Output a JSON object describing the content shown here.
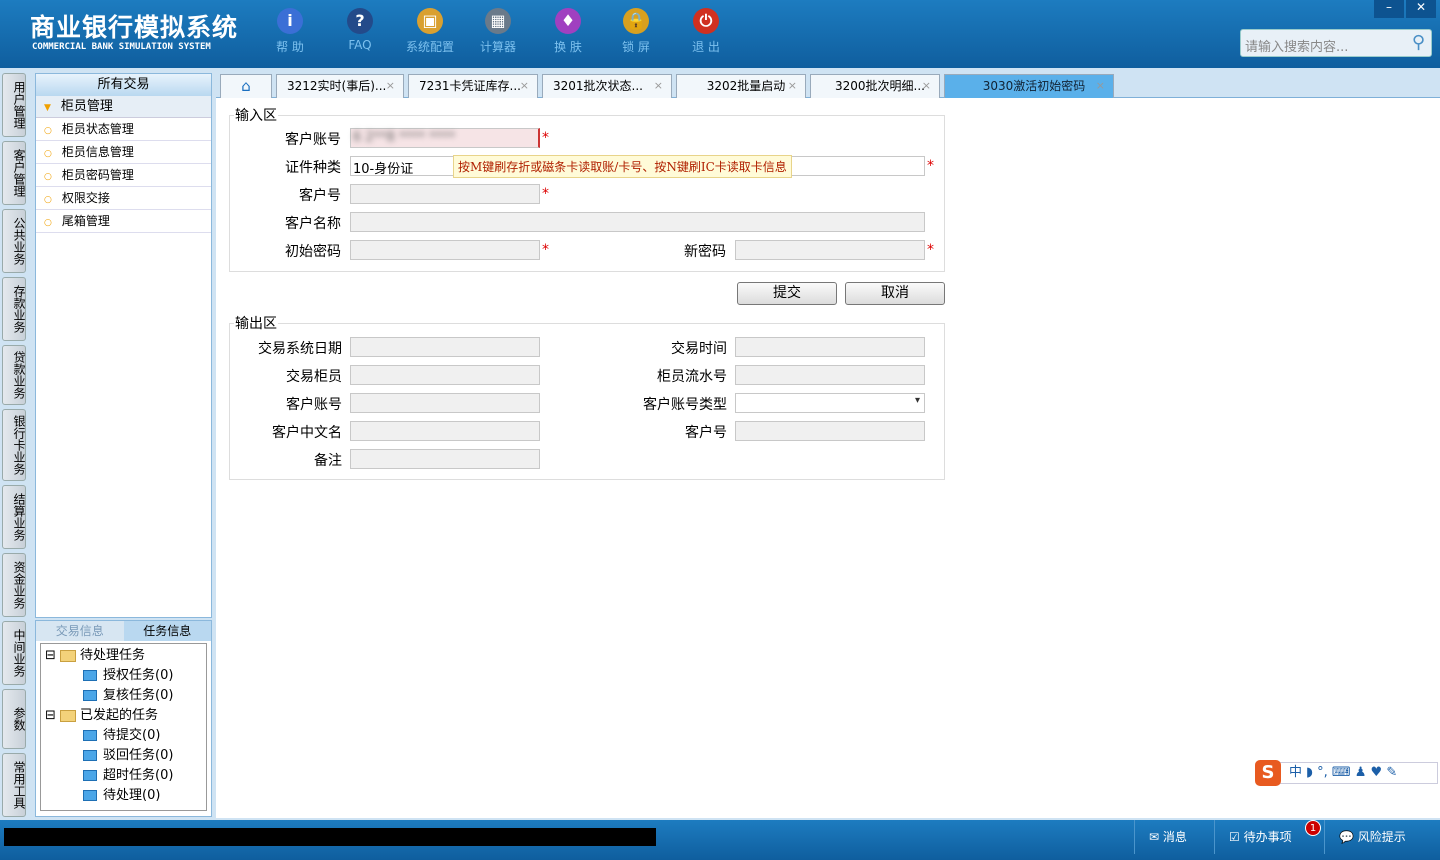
{
  "app": {
    "title": "商业银行模拟系统",
    "subtitle": "COMMERCIAL BANK SIMULATION SYSTEM"
  },
  "toolbar": [
    {
      "label": "帮 助",
      "icon": "info-icon",
      "color": "#3b6fd6",
      "glyph": "i"
    },
    {
      "label": "FAQ",
      "icon": "question-icon",
      "color": "#234a8a",
      "glyph": "?"
    },
    {
      "label": "系统配置",
      "icon": "toolbox-icon",
      "color": "#d9a030",
      "glyph": "▣"
    },
    {
      "label": "计算器",
      "icon": "calculator-icon",
      "color": "#6a7a8a",
      "glyph": "▦"
    },
    {
      "label": "换 肤",
      "icon": "shirt-icon",
      "color": "#a040c0",
      "glyph": "♦"
    },
    {
      "label": "锁 屏",
      "icon": "lock-icon",
      "color": "#d8a020",
      "glyph": "🔒"
    },
    {
      "label": "退 出",
      "icon": "power-icon",
      "color": "#d03020",
      "glyph": "⏻"
    }
  ],
  "search": {
    "placeholder": "请输入搜索内容..."
  },
  "vtabs": [
    "用户管理",
    "客户管理",
    "公共业务",
    "存款业务",
    "贷款业务",
    "银行卡业务",
    "结算业务",
    "资金业务",
    "中间业务",
    "参数",
    "常用工具"
  ],
  "left": {
    "header": "所有交易",
    "group": "柜员管理",
    "items": [
      "柜员状态管理",
      "柜员信息管理",
      "柜员密码管理",
      "权限交接",
      "尾箱管理"
    ]
  },
  "tasks": {
    "tabs": [
      "交易信息",
      "任务信息"
    ],
    "tree": [
      {
        "label": "待处理任务",
        "children": [
          "授权任务(0)",
          "复核任务(0)"
        ]
      },
      {
        "label": "已发起的任务",
        "children": [
          "待提交(0)",
          "驳回任务(0)",
          "超时任务(0)",
          "待处理(0)"
        ]
      }
    ]
  },
  "tabs": [
    "3212实时(事后)...",
    "7231卡凭证库存...",
    "3201批次状态...",
    "3202批量启动",
    "3200批次明细...",
    "3030激活初始密码"
  ],
  "input": {
    "legend": "输入区",
    "account_label": "客户账号",
    "idtype_label": "证件种类",
    "idtype_value": "10-身份证",
    "custno_label": "客户号",
    "custname_label": "客户名称",
    "initpwd_label": "初始密码",
    "newpwd_label": "新密码",
    "tooltip": "按M键刷存折或磁条卡读取账/卡号、按N键刷IC卡读取卡信息"
  },
  "buttons": {
    "submit": "提交",
    "cancel": "取消"
  },
  "output": {
    "legend": "输出区",
    "date": "交易系统日期",
    "time": "交易时间",
    "teller": "交易柜员",
    "serial": "柜员流水号",
    "account": "客户账号",
    "acctype": "客户账号类型",
    "cnname": "客户中文名",
    "custno": "客户号",
    "remark": "备注"
  },
  "ime": {
    "label": "中 ◗ °, ⌨ ♟ ♥ ✎"
  },
  "status": {
    "message": "消息",
    "todo": "待办事项",
    "todo_count": "1",
    "risk": "风险提示"
  }
}
